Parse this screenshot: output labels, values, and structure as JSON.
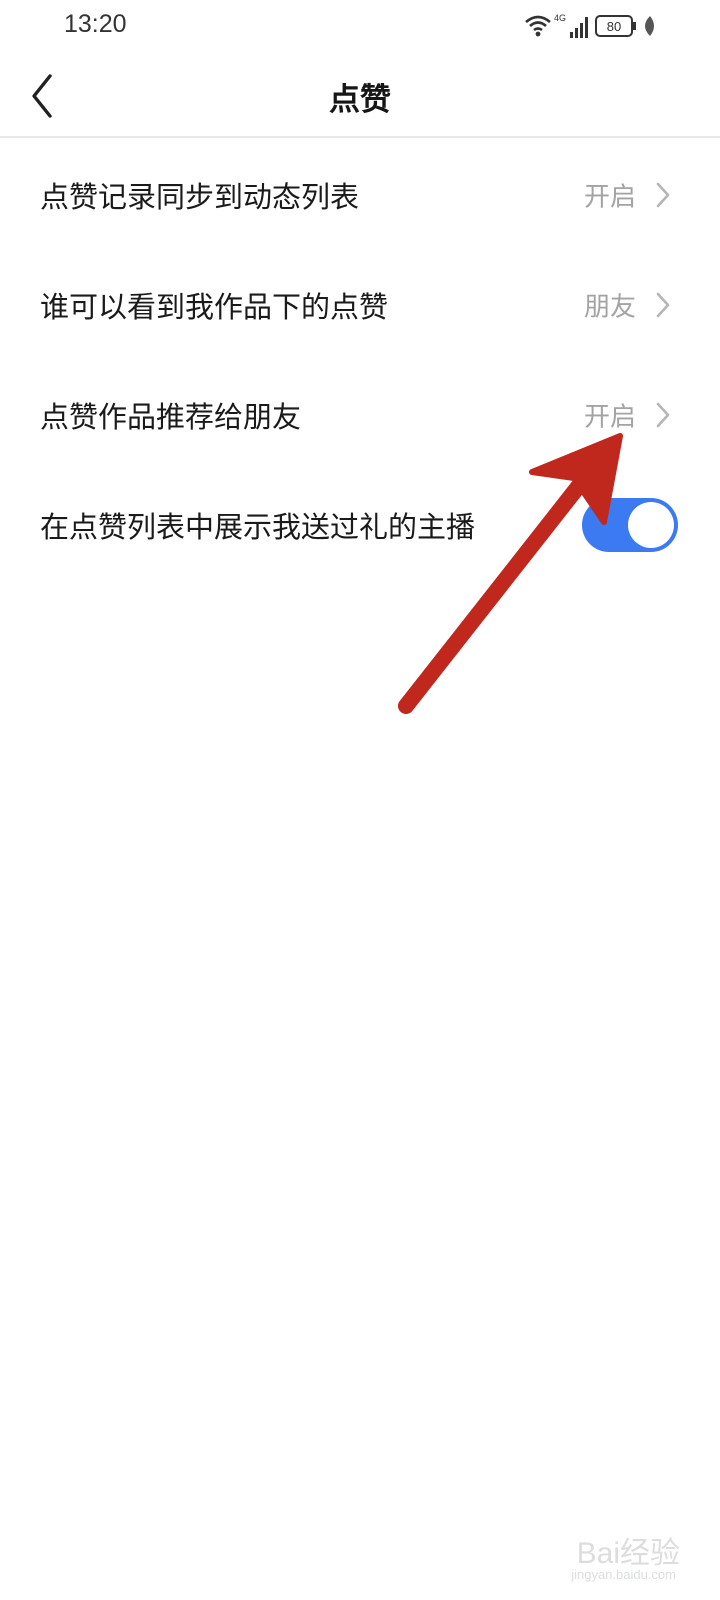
{
  "status_bar": {
    "time": "13:20",
    "network": "4G",
    "battery": "80",
    "icons": [
      "wifi-icon",
      "signal-icon",
      "battery-icon",
      "leaf-icon"
    ]
  },
  "header": {
    "title": "点赞",
    "back_icon": "chevron-left-icon"
  },
  "settings": [
    {
      "label": "点赞记录同步到动态列表",
      "value": "开启",
      "type": "link"
    },
    {
      "label": "谁可以看到我作品下的点赞",
      "value": "朋友",
      "type": "link"
    },
    {
      "label": "点赞作品推荐给朋友",
      "value": "开启",
      "type": "link"
    },
    {
      "label": "在点赞列表中展示我送过礼的主播",
      "type": "toggle",
      "toggle_on": true
    }
  ],
  "annotation": {
    "arrow_color": "#c0281e"
  },
  "watermark": {
    "text": "Bai经验",
    "sub": "jingyan.baidu.com"
  },
  "colors": {
    "toggle_on": "#3b7af0",
    "value_text": "#a3a3a3",
    "divider": "#e8e8e8"
  }
}
